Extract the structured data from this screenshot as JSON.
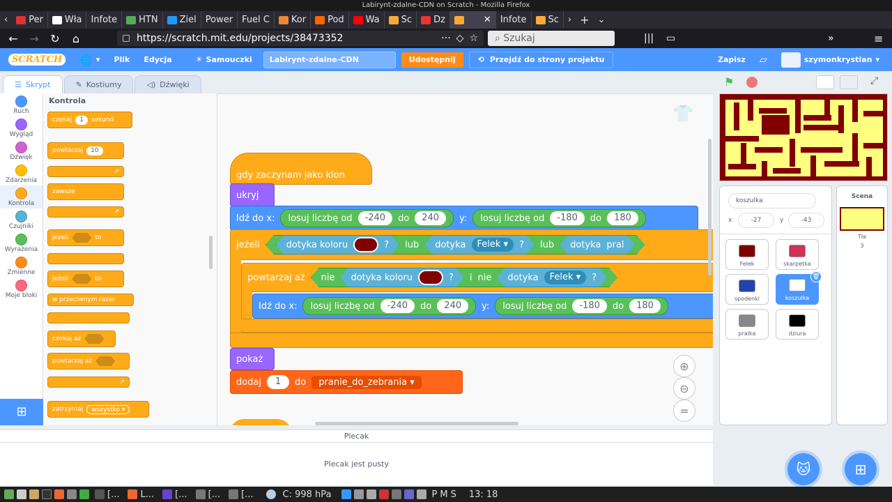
{
  "window_title": "Labirynt-zdalne-CDN on Scratch - Mozilla Firefox",
  "tabs": [
    "Per",
    "Wła",
    "Infote",
    "HTN",
    "Ziel",
    "Power",
    "Fuel C",
    "Kor",
    "Pod",
    "Wa",
    "Sc",
    "Dz",
    "",
    "Infote",
    "Sc"
  ],
  "url": "https://scratch.mit.edu/projects/38473352",
  "search_placeholder": "Szukaj",
  "menu": {
    "logo": "SCRATCH",
    "file": "Plik",
    "edit": "Edycja",
    "tutorials": "Samouczki",
    "project_title": "Labirynt-zdalne-CDN",
    "share": "Udostępnij",
    "see_project": "Przejdź do strony projektu",
    "save": "Zapisz",
    "username": "szymonkrystian"
  },
  "editor_tabs": [
    "Skrypt",
    "Kostiumy",
    "Dźwięki"
  ],
  "categories": [
    {
      "label": "Ruch",
      "color": "#4c97ff"
    },
    {
      "label": "Wygląd",
      "color": "#9966ff"
    },
    {
      "label": "Dźwięk",
      "color": "#cf63cf"
    },
    {
      "label": "Zdarzenia",
      "color": "#ffbf00"
    },
    {
      "label": "Kontrola",
      "color": "#ffab19"
    },
    {
      "label": "Czujniki",
      "color": "#5cb1d6"
    },
    {
      "label": "Wyrażenia",
      "color": "#59c059"
    },
    {
      "label": "Zmienne",
      "color": "#ff8c1a"
    },
    {
      "label": "Moje bloki",
      "color": "#ff6680"
    }
  ],
  "palette": {
    "header": "Kontrola",
    "wait_pre": "czekaj",
    "wait_val": "1",
    "wait_post": "sekund",
    "repeat": "powtarzaj",
    "repeat_val": "10",
    "forever": "zawsze",
    "if1": "jeżeli",
    "then1": "to",
    "if2": "jeżeli",
    "then2": "to",
    "else": "w przeciwnym razie",
    "wait_until": "czekaj aż",
    "repeat_until": "powtarzaj aż",
    "stop": "zatrzymaj",
    "stop_opt": "wszystko ▾"
  },
  "script": {
    "hat": "gdy zaczynam jako klon",
    "hide": "ukryj",
    "goto1": {
      "label": "Idź do x:",
      "rand1": "losuj liczbę od",
      "a": "-240",
      "to1": "do",
      "b": "240",
      "y": "y:",
      "rand2": "losuj liczbę od",
      "c": "-180",
      "to2": "do",
      "d": "180"
    },
    "if": "jeżeli",
    "touch_color": "dotyka koloru",
    "q1": "?",
    "or1": "lub",
    "touch1": "dotyka",
    "touch1_opt": "Felek ▾",
    "q2": "?",
    "or2": "lub",
    "touch2": "dotyka",
    "touch2_opt": "pral",
    "repeat_until": "powtarzaj aż",
    "not1": "nie",
    "touch_color2": "dotyka koloru",
    "q3": "?",
    "and": "i",
    "not2": "nie",
    "touch3": "dotyka",
    "touch3_opt": "Felek ▾",
    "q4": "?",
    "goto2": {
      "label": "Idź do x:",
      "rand1": "losuj liczbę od",
      "a": "-240",
      "to1": "do",
      "b": "240",
      "y": "y:",
      "rand2": "losuj liczbę od",
      "c": "-180",
      "to2": "do",
      "d": "180"
    },
    "show": "pokaż",
    "change_pre": "dodaj",
    "change_val": "1",
    "change_mid": "do",
    "change_var": "pranie_do_zebrania ▾"
  },
  "sprite_info": {
    "name": "koszulka",
    "x_label": "x",
    "x": "-27",
    "y_label": "y",
    "y": "-43"
  },
  "sprites": [
    {
      "name": "Felek",
      "color": "#800000"
    },
    {
      "name": "skarpetka",
      "color": "#cc3355"
    },
    {
      "name": "spodenki",
      "color": "#2244aa"
    },
    {
      "name": "koszulka",
      "color": "#ffffff"
    },
    {
      "name": "pralka",
      "color": "#888888"
    },
    {
      "name": "dziura",
      "color": "#000000"
    }
  ],
  "scene": {
    "label": "Scena",
    "backdrops_label": "Tła",
    "backdrops_count": "3"
  },
  "backpack": {
    "title": "Plecak",
    "empty": "Plecak jest pusty"
  },
  "taskbar": {
    "items": [
      "[...",
      "L...",
      "[...",
      "[...",
      "[..."
    ],
    "pressure": "C: 998 hPa",
    "lang": "P",
    "lang2": "M",
    "lang3": "S",
    "clock": "13: 18"
  }
}
